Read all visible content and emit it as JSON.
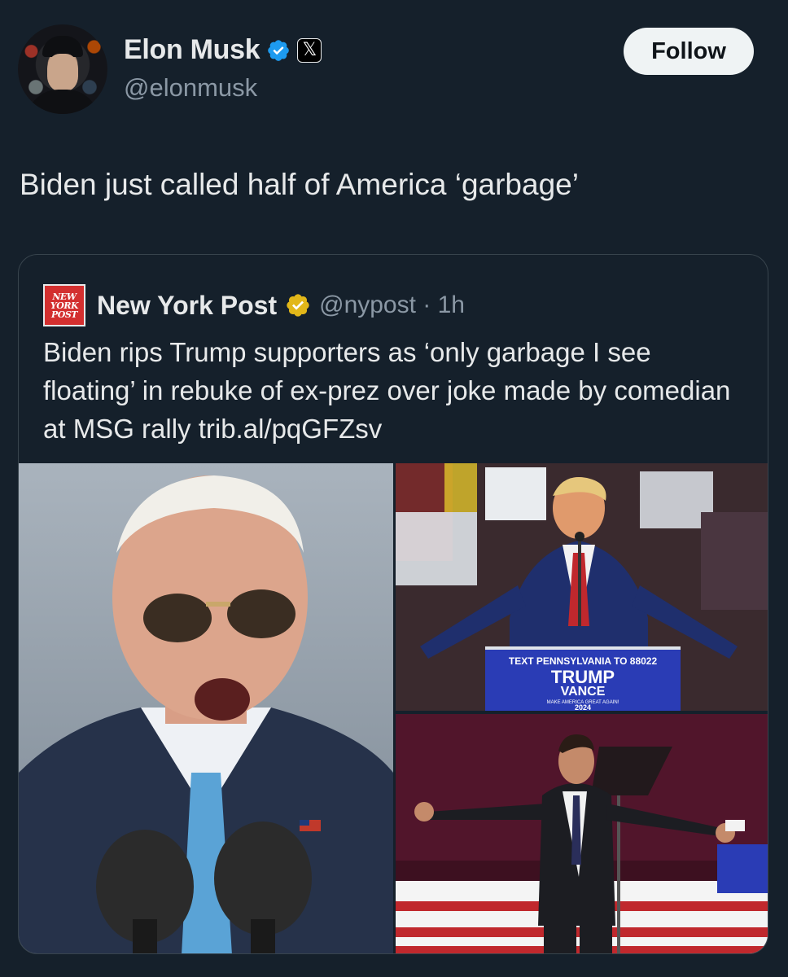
{
  "author": {
    "name": "Elon Musk",
    "handle": "@elonmusk",
    "verified_icon": "blue-check-icon",
    "affiliate_icon": "x-logo-icon",
    "affiliate_glyph": "𝕏"
  },
  "follow_label": "Follow",
  "tweet_text": "Biden just called half of America ‘garbage’",
  "quote": {
    "logo_text": "NEW YORK POST",
    "name": "New York Post",
    "verified_icon": "gold-check-icon",
    "handle_time": "@nypost · 1h",
    "text": "Biden rips Trump supporters as ‘only garbage I see floating’ in rebuke of ex-prez over joke made by comedian at MSG rally trib.al/pqGFZsv",
    "sign_text": "TEXT PENNSYLVANIA TO 88022",
    "sign_line1": "TRUMP",
    "sign_line2": "VANCE",
    "sign_small": "MAKE AMERICA GREAT AGAIN!",
    "sign_year": "2024"
  },
  "colors": {
    "background": "#15202b",
    "text": "#e7e9ea",
    "secondary": "#8b98a5",
    "verified_blue": "#1d9bf0",
    "verified_gold": "#e2b719",
    "nypost_red": "#d32f2f"
  }
}
